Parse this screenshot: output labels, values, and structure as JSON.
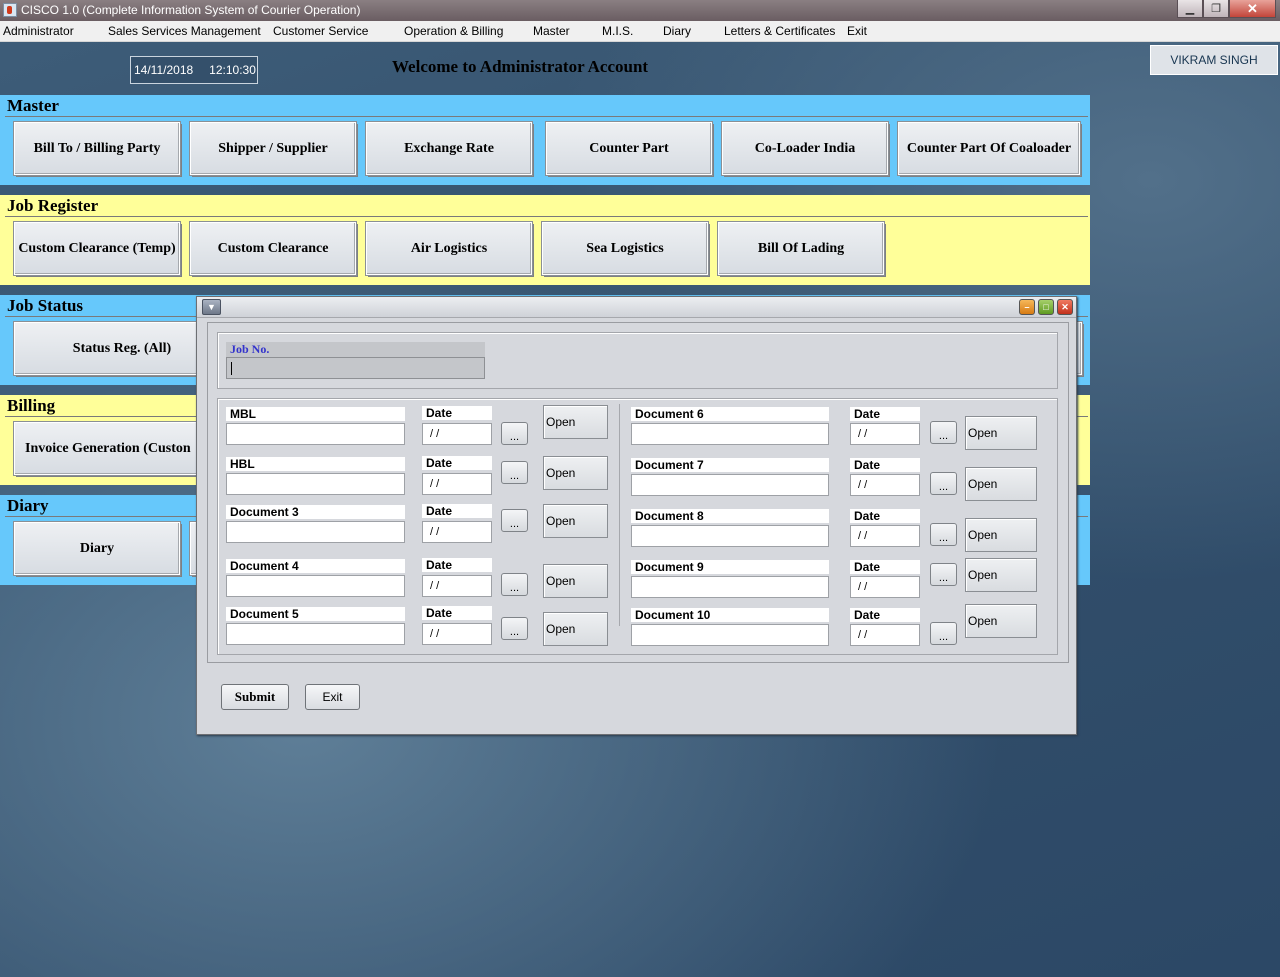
{
  "window": {
    "title": "CISCO 1.0 (Complete Information System of Courier Operation)",
    "min_glyph": "▁",
    "max_glyph": "❐",
    "close_glyph": "✕"
  },
  "menu": [
    "Administrator",
    "Sales Services Management",
    "Customer Service",
    "Operation & Billing",
    "Master",
    "M.I.S.",
    "Diary",
    "Letters & Certificates",
    "Exit"
  ],
  "header": {
    "date": "14/11/2018",
    "time": "12:10:30",
    "welcome": "Welcome to Administrator Account",
    "user": "VIKRAM SINGH"
  },
  "sections": {
    "master": {
      "title": "Master",
      "buttons": [
        "Bill To / Billing Party",
        "Shipper / Supplier",
        "Exchange Rate",
        "Counter Part",
        "Co-Loader India",
        "Counter Part Of Coaloader"
      ]
    },
    "job_register": {
      "title": "Job Register",
      "buttons": [
        "Custom Clearance (Temp)",
        "Custom Clearance",
        "Air Logistics",
        "Sea Logistics",
        "Bill Of Lading"
      ]
    },
    "job_status": {
      "title": "Job Status",
      "buttons": [
        "Status Reg. (All)"
      ]
    },
    "billing": {
      "title": "Billing",
      "buttons": [
        "Invoice Generation (Custon"
      ]
    },
    "diary": {
      "title": "Diary",
      "buttons": [
        "Diary"
      ]
    }
  },
  "colors": {
    "blue_section": "#66c8fb",
    "yellow_section": "#ffff99",
    "job_label": "#3333cc"
  },
  "dialog": {
    "job_no_label": "Job No.",
    "job_no_value": "",
    "date_label": "Date",
    "date_value": "/ /",
    "browse_label": "...",
    "open_label": "Open",
    "docs_left": [
      {
        "label": "MBL"
      },
      {
        "label": "HBL"
      },
      {
        "label": "Document 3"
      },
      {
        "label": "Document 4"
      },
      {
        "label": "Document 5"
      }
    ],
    "docs_right": [
      {
        "label": "Document 6"
      },
      {
        "label": "Document 7"
      },
      {
        "label": "Document 8"
      },
      {
        "label": "Document 9"
      },
      {
        "label": "Document 10"
      }
    ],
    "submit_label": "Submit",
    "exit_label": "Exit"
  }
}
